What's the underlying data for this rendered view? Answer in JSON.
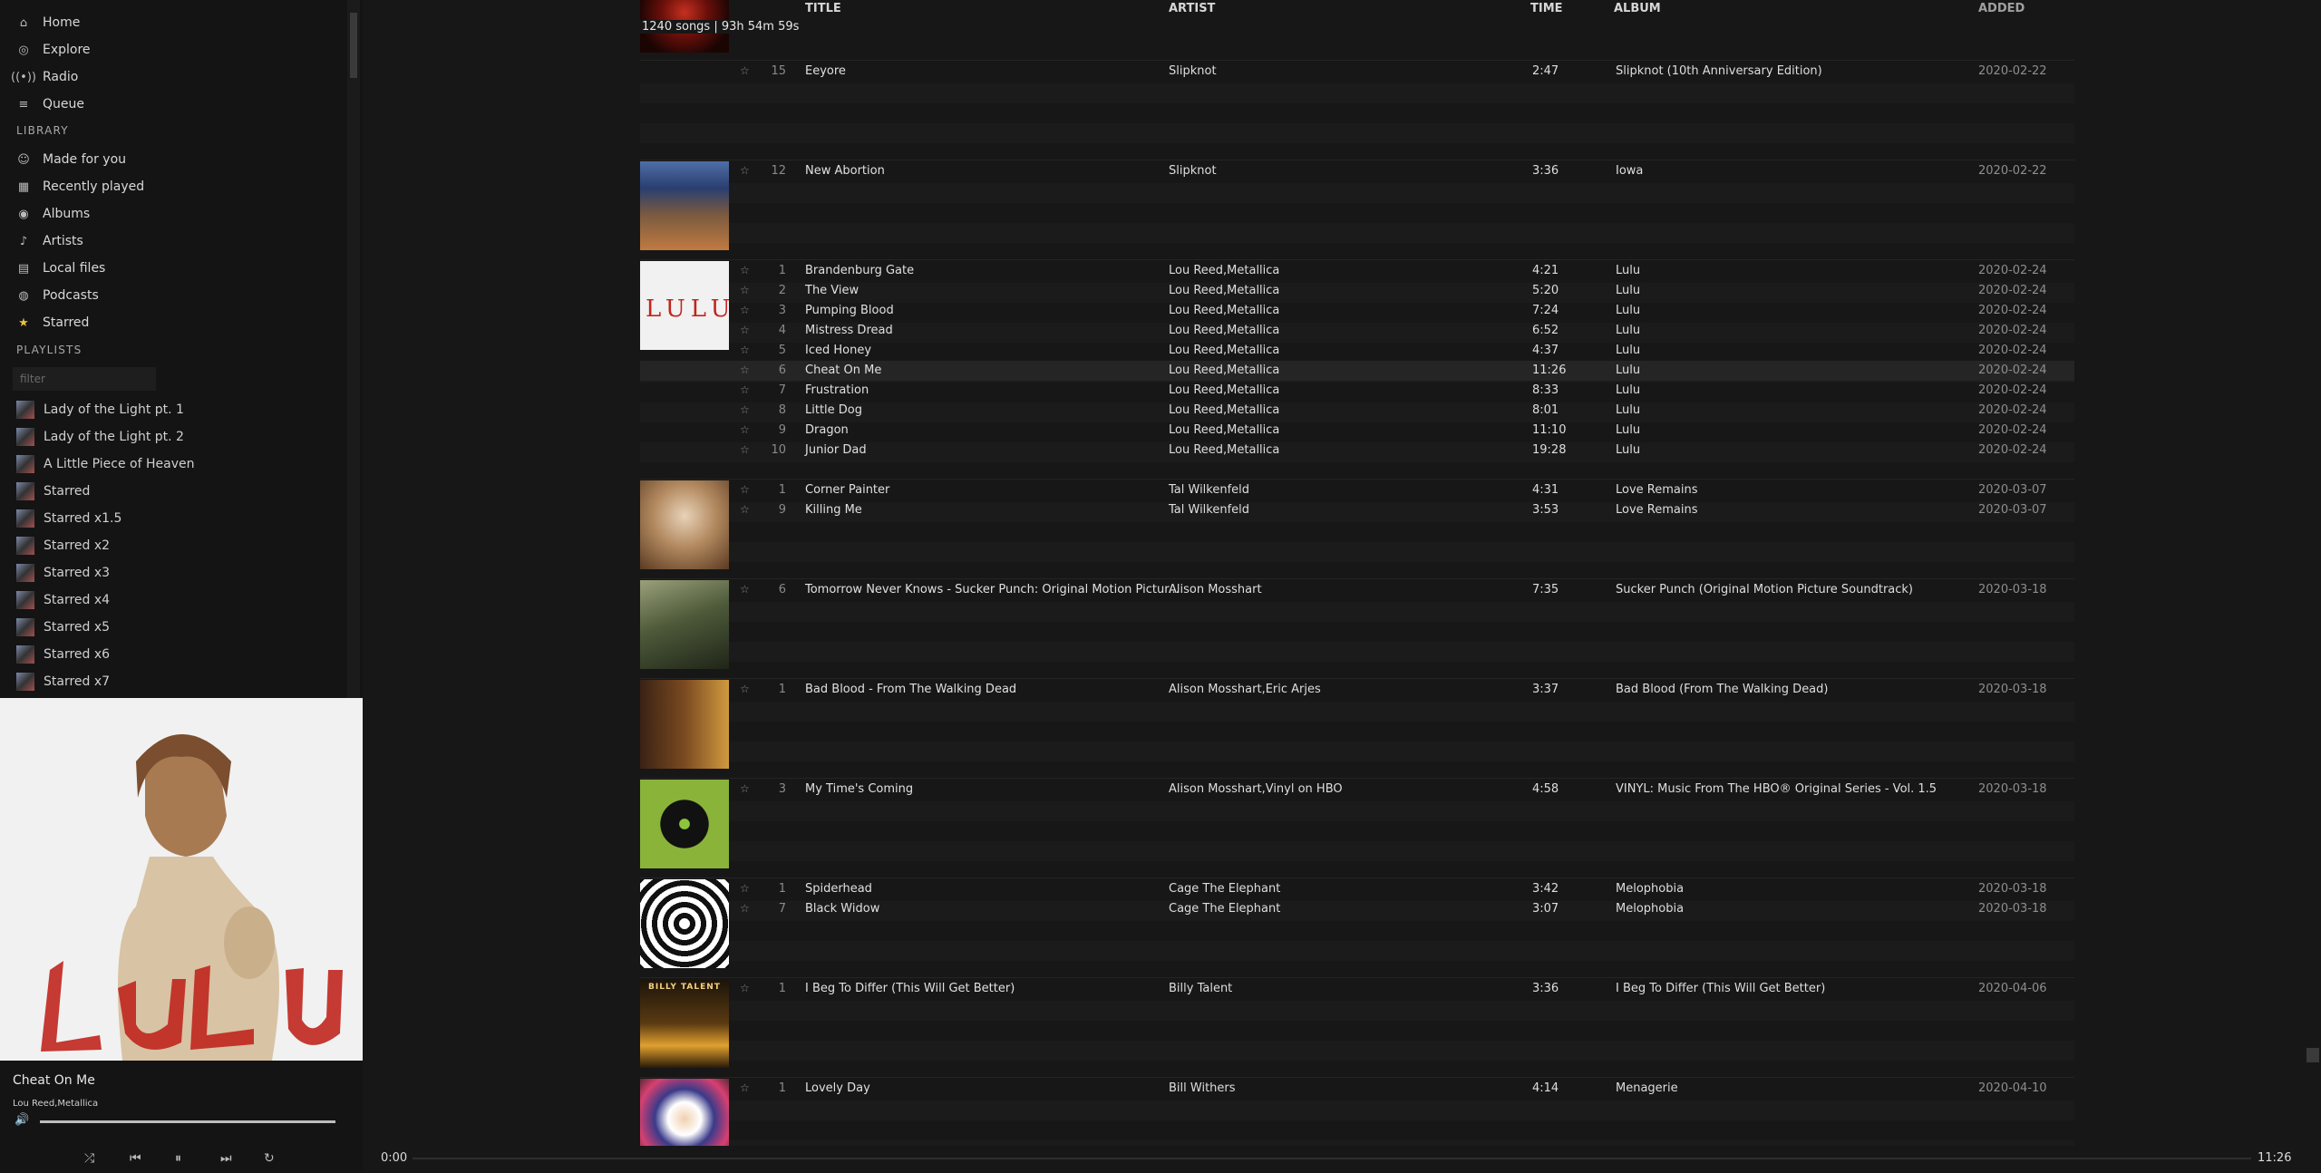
{
  "nav": {
    "items": [
      {
        "label": "Home",
        "icon": "home-icon"
      },
      {
        "label": "Explore",
        "icon": "compass-icon"
      },
      {
        "label": "Radio",
        "icon": "radio-icon"
      },
      {
        "label": "Queue",
        "icon": "list-icon"
      }
    ]
  },
  "library": {
    "heading": "LIBRARY",
    "items": [
      {
        "label": "Made for you",
        "icon": "user-circle-icon"
      },
      {
        "label": "Recently played",
        "icon": "calendar-icon"
      },
      {
        "label": "Albums",
        "icon": "disc-icon"
      },
      {
        "label": "Artists",
        "icon": "microphone-icon"
      },
      {
        "label": "Local files",
        "icon": "file-icon"
      },
      {
        "label": "Podcasts",
        "icon": "podcast-icon"
      },
      {
        "label": "Starred",
        "icon": "star-icon"
      }
    ]
  },
  "playlists": {
    "heading": "PLAYLISTS",
    "filter_placeholder": "filter",
    "items": [
      {
        "label": "Lady of the Light pt. 1"
      },
      {
        "label": "Lady of the Light pt. 2"
      },
      {
        "label": "A Little Piece of Heaven"
      },
      {
        "label": "Starred"
      },
      {
        "label": "Starred x1.5"
      },
      {
        "label": "Starred x2"
      },
      {
        "label": "Starred x3"
      },
      {
        "label": "Starred x4"
      },
      {
        "label": "Starred x5"
      },
      {
        "label": "Starred x6"
      },
      {
        "label": "Starred x7"
      }
    ]
  },
  "now_playing": {
    "cover_text": "LULU",
    "title": "Cheat On Me",
    "artist": "Lou Reed,Metallica",
    "volume_fraction": 1.0
  },
  "controls": {
    "shuffle": "shuffle-icon",
    "prev": "previous-icon",
    "pause": "pause-icon",
    "next": "next-icon",
    "repeat": "repeat-icon"
  },
  "seek": {
    "current": "0:00",
    "total": "11:26",
    "progress_fraction": 0.0
  },
  "table": {
    "song_count": "1240 songs | 93h 54m 59s",
    "columns": {
      "title": "TITLE",
      "artist": "ARTIST",
      "time": "TIME",
      "album": "ALBUM",
      "added": "ADDED"
    },
    "groups": [
      {
        "art": "art-slipknot-10th",
        "rows": [
          {
            "n": "15",
            "title": "Eeyore",
            "artist": "Slipknot",
            "time": "2:47",
            "album": "Slipknot (10th Anniversary Edition)",
            "added": "2020-02-22"
          }
        ]
      },
      {
        "art": "art-iowa",
        "rows": [
          {
            "n": "12",
            "title": "New Abortion",
            "artist": "Slipknot",
            "time": "3:36",
            "album": "Iowa",
            "added": "2020-02-22"
          }
        ]
      },
      {
        "art": "art-lulu",
        "rows": [
          {
            "n": "1",
            "title": "Brandenburg Gate",
            "artist": "Lou Reed,Metallica",
            "time": "4:21",
            "album": "Lulu",
            "added": "2020-02-24"
          },
          {
            "n": "2",
            "title": "The View",
            "artist": "Lou Reed,Metallica",
            "time": "5:20",
            "album": "Lulu",
            "added": "2020-02-24"
          },
          {
            "n": "3",
            "title": "Pumping Blood",
            "artist": "Lou Reed,Metallica",
            "time": "7:24",
            "album": "Lulu",
            "added": "2020-02-24"
          },
          {
            "n": "4",
            "title": "Mistress Dread",
            "artist": "Lou Reed,Metallica",
            "time": "6:52",
            "album": "Lulu",
            "added": "2020-02-24"
          },
          {
            "n": "5",
            "title": "Iced Honey",
            "artist": "Lou Reed,Metallica",
            "time": "4:37",
            "album": "Lulu",
            "added": "2020-02-24"
          },
          {
            "n": "6",
            "title": "Cheat On Me",
            "artist": "Lou Reed,Metallica",
            "time": "11:26",
            "album": "Lulu",
            "added": "2020-02-24"
          },
          {
            "n": "7",
            "title": "Frustration",
            "artist": "Lou Reed,Metallica",
            "time": "8:33",
            "album": "Lulu",
            "added": "2020-02-24"
          },
          {
            "n": "8",
            "title": "Little Dog",
            "artist": "Lou Reed,Metallica",
            "time": "8:01",
            "album": "Lulu",
            "added": "2020-02-24"
          },
          {
            "n": "9",
            "title": "Dragon",
            "artist": "Lou Reed,Metallica",
            "time": "11:10",
            "album": "Lulu",
            "added": "2020-02-24"
          },
          {
            "n": "10",
            "title": "Junior Dad",
            "artist": "Lou Reed,Metallica",
            "time": "19:28",
            "album": "Lulu",
            "added": "2020-02-24"
          }
        ]
      },
      {
        "art": "art-love-remains",
        "rows": [
          {
            "n": "1",
            "title": "Corner Painter",
            "artist": "Tal Wilkenfeld",
            "time": "4:31",
            "album": "Love Remains",
            "added": "2020-03-07"
          },
          {
            "n": "9",
            "title": "Killing Me",
            "artist": "Tal Wilkenfeld",
            "time": "3:53",
            "album": "Love Remains",
            "added": "2020-03-07"
          }
        ]
      },
      {
        "art": "art-sucker-punch",
        "rows": [
          {
            "n": "6",
            "title": "Tomorrow Never Knows - Sucker Punch: Original Motion Pictur...",
            "artist": "Alison Mosshart",
            "time": "7:35",
            "album": "Sucker Punch (Original Motion Picture Soundtrack)",
            "added": "2020-03-18"
          }
        ]
      },
      {
        "art": "art-walking-dead",
        "rows": [
          {
            "n": "1",
            "title": "Bad Blood - From The Walking Dead",
            "artist": "Alison Mosshart,Eric Arjes",
            "time": "3:37",
            "album": "Bad Blood (From The Walking Dead)",
            "added": "2020-03-18"
          }
        ]
      },
      {
        "art": "art-vinyl",
        "rows": [
          {
            "n": "3",
            "title": "My Time's Coming",
            "artist": "Alison Mosshart,Vinyl on HBO",
            "time": "4:58",
            "album": "VINYL: Music From The HBO® Original Series - Vol. 1.5",
            "added": "2020-03-18"
          }
        ]
      },
      {
        "art": "art-melophobia",
        "rows": [
          {
            "n": "1",
            "title": "Spiderhead",
            "artist": "Cage The Elephant",
            "time": "3:42",
            "album": "Melophobia",
            "added": "2020-03-18"
          },
          {
            "n": "7",
            "title": "Black Widow",
            "artist": "Cage The Elephant",
            "time": "3:07",
            "album": "Melophobia",
            "added": "2020-03-18"
          }
        ]
      },
      {
        "art": "art-billy-talent",
        "art_text": "BILLY TALENT",
        "rows": [
          {
            "n": "1",
            "title": "I Beg To Differ (This Will Get Better)",
            "artist": "Billy Talent",
            "time": "3:36",
            "album": "I Beg To Differ (This Will Get Better)",
            "added": "2020-04-06"
          }
        ]
      },
      {
        "art": "art-menagerie",
        "rows": [
          {
            "n": "1",
            "title": "Lovely Day",
            "artist": "Bill Withers",
            "time": "4:14",
            "album": "Menagerie",
            "added": "2020-04-10"
          }
        ]
      }
    ]
  }
}
